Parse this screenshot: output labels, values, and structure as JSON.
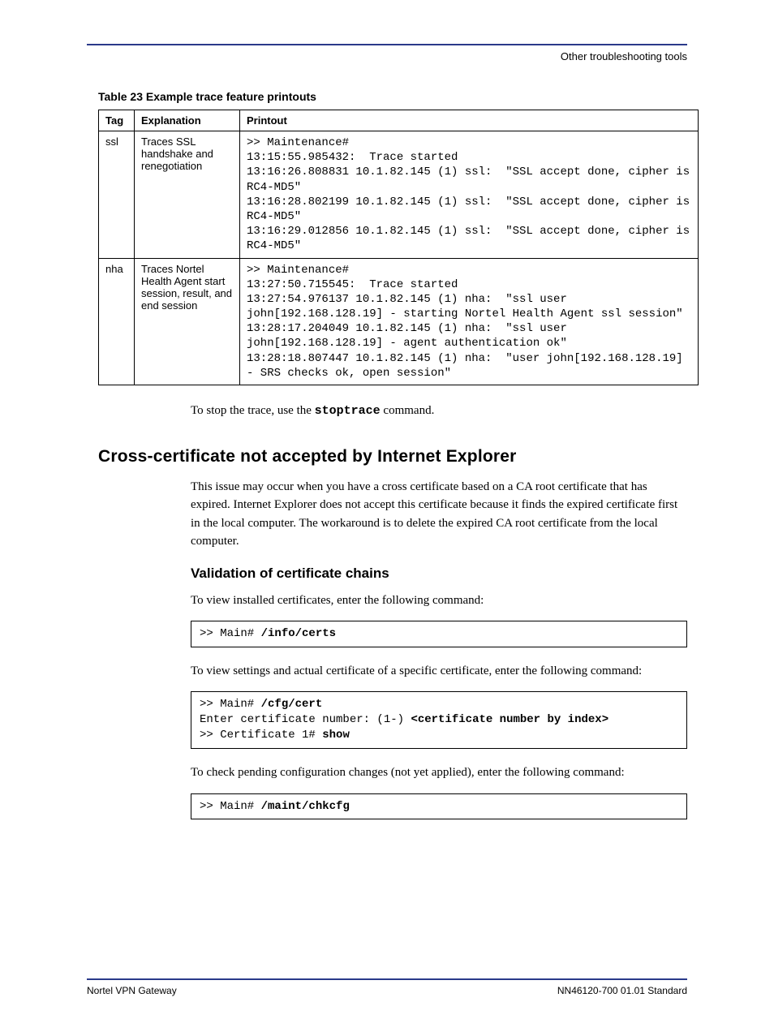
{
  "header": {
    "right": "Other troubleshooting tools"
  },
  "table_caption": "Table 23   Example trace feature printouts",
  "table": {
    "headers": [
      "Tag",
      "Explanation",
      "Printout"
    ],
    "rows": [
      {
        "tag": "ssl",
        "explanation": "Traces SSL handshake and renegotiation",
        "printout": ">> Maintenance#\n13:15:55.985432:  Trace started\n13:16:26.808831 10.1.82.145 (1) ssl:  \"SSL accept done, cipher is RC4-MD5\"\n13:16:28.802199 10.1.82.145 (1) ssl:  \"SSL accept done, cipher is RC4-MD5\"\n13:16:29.012856 10.1.82.145 (1) ssl:  \"SSL accept done, cipher is RC4-MD5\""
      },
      {
        "tag": "nha",
        "explanation": "Traces Nortel Health Agent start session, result, and end session",
        "printout": ">> Maintenance#\n13:27:50.715545:  Trace started\n13:27:54.976137 10.1.82.145 (1) nha:  \"ssl user john[192.168.128.19] - starting Nortel Health Agent ssl session\"\n13:28:17.204049 10.1.82.145 (1) nha:  \"ssl user john[192.168.128.19] - agent authentication ok\"\n13:28:18.807447 10.1.82.145 (1) nha:  \"user john[192.168.128.19] - SRS checks ok, open session\""
      }
    ]
  },
  "para1_a": "To stop the trace, use the ",
  "para1_cmd": "stoptrace",
  "para1_b": " command.",
  "section_heading": "Cross-certificate not accepted by Internet Explorer",
  "para2": "This issue may occur when you have a cross certificate based on a CA root certificate that has expired. Internet Explorer does not accept this certificate because it finds the expired certificate first in the local computer. The workaround is to delete the expired CA root certificate from the local computer.",
  "subsection_heading": "Validation of certificate chains",
  "para3": "To view installed certificates, enter the following command:",
  "cmd1": {
    "prompt": ">> Main# ",
    "bold": "/info/certs"
  },
  "para4": "To view settings and actual certificate of a specific certificate, enter the following command:",
  "cmd2": {
    "line1_prompt": ">> Main# ",
    "line1_bold": "/cfg/cert",
    "line2_prompt": "Enter certificate number:  (1-) ",
    "line2_bold": "<certificate number by index>",
    "line3_prompt": ">> Certificate 1# ",
    "line3_bold": "show"
  },
  "para5": "To check pending configuration changes (not yet applied), enter the following command:",
  "cmd3": {
    "prompt": ">> Main# ",
    "bold": "/maint/chkcfg"
  },
  "footer": {
    "left": "Nortel VPN Gateway",
    "right": "NN46120-700   01.01   Standard"
  }
}
